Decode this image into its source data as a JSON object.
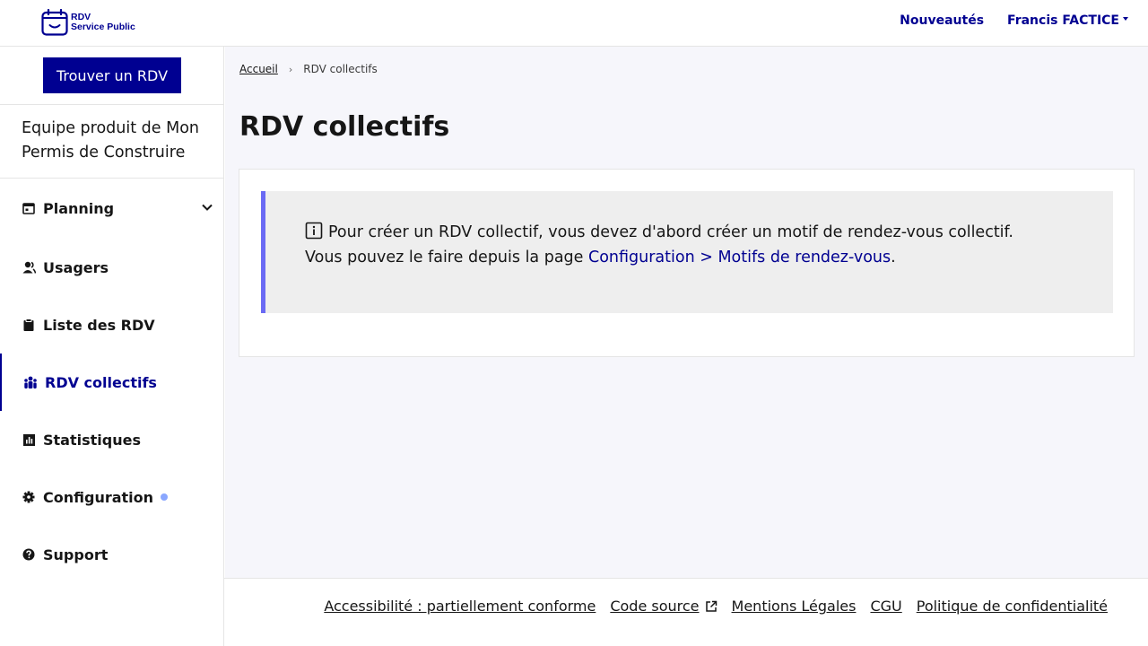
{
  "header": {
    "logo_line1": "RDV",
    "logo_line2": "Service Public",
    "nav": [
      {
        "label": "Nouveautés"
      },
      {
        "label": "Francis FACTICE"
      }
    ]
  },
  "sidebar": {
    "cta_label": "Trouver un RDV",
    "organisation": "Equipe produit de Mon Permis de Construire",
    "items": [
      {
        "label": "Planning",
        "icon": "calendar-icon"
      },
      {
        "label": "Usagers",
        "icon": "user-icon"
      },
      {
        "label": "Liste des RDV",
        "icon": "clipboard-icon"
      },
      {
        "label": "RDV collectifs",
        "icon": "group-icon",
        "active": true
      },
      {
        "label": "Statistiques",
        "icon": "bar-chart-icon"
      },
      {
        "label": "Configuration",
        "icon": "gear-icon"
      },
      {
        "label": "Support",
        "icon": "question-icon"
      }
    ]
  },
  "breadcrumb": {
    "home": "Accueil",
    "current": "RDV collectifs"
  },
  "main": {
    "title": "RDV collectifs",
    "callout_line1": "Pour créer un RDV collectif, vous devez d'abord créer un motif de rendez-vous collectif.",
    "callout_line2_prefix": "Vous pouvez le faire depuis la page ",
    "callout_link": "Configuration > Motifs de rendez-vous",
    "callout_line2_suffix": "."
  },
  "footer": {
    "links": [
      {
        "label": "Accessibilité : partiellement conforme"
      },
      {
        "label": "Code source"
      },
      {
        "label": "Mentions Légales"
      },
      {
        "label": "CGU"
      },
      {
        "label": "Politique de confidentialité"
      }
    ]
  },
  "colors": {
    "primary": "#000091",
    "callout_border": "#6a6af4",
    "main_bg": "#f6f6fb",
    "notification_dot": "#8aa7ff"
  }
}
